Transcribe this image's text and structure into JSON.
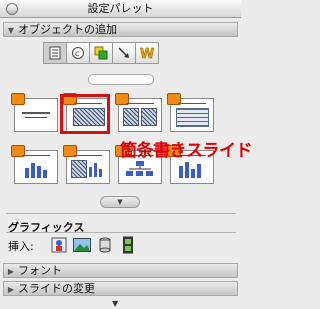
{
  "window": {
    "title": "設定パレット"
  },
  "sections": {
    "object_add": {
      "label": "オブジェクトの追加"
    },
    "graphics": {
      "label": "グラフィックス",
      "insert_label": "挿入:"
    },
    "font": {
      "label": "フォント"
    },
    "slide_change": {
      "label": "スライドの変更"
    }
  },
  "toolbar": {
    "tools": [
      "layout-icon",
      "copyright-icon",
      "shapes-icon",
      "arrow-icon",
      "wordart-icon"
    ]
  },
  "layouts": [
    "title-layout",
    "bulleted-text-layout",
    "two-column-layout",
    "table-layout",
    "chart-layout",
    "text-and-chart-layout",
    "org-chart-layout",
    "chart-and-text-layout"
  ],
  "selected_layout": "bulleted-text-layout",
  "annotation": {
    "text": "箇条書きスライド",
    "color": "#e00000"
  },
  "insert_icons": [
    "clip-art-icon",
    "picture-icon",
    "shape-icon",
    "movie-icon"
  ]
}
